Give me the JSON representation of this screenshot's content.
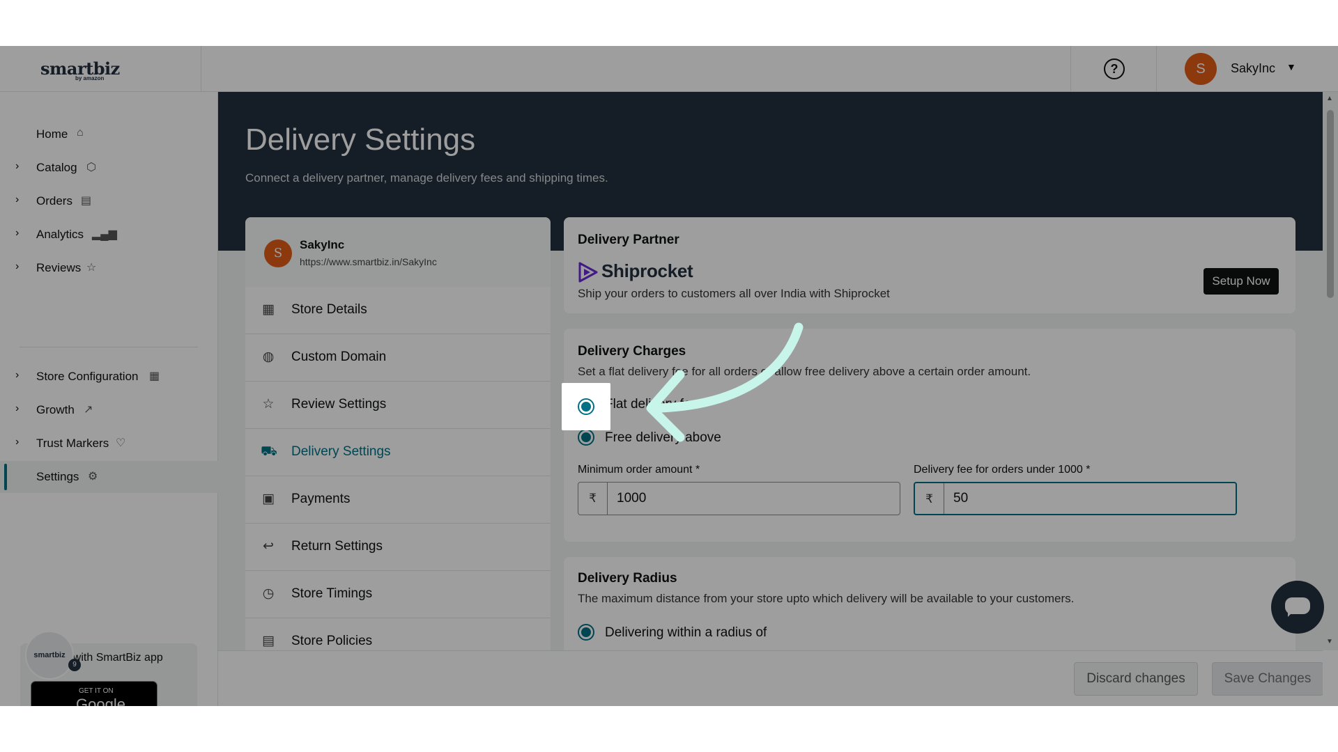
{
  "topbar": {
    "logo_text": "smartbiz",
    "logo_sub": "by amazon",
    "help_label": "?",
    "user_initial": "S",
    "user_name": "SakyInc"
  },
  "sidebar": {
    "items": [
      {
        "label": "Home",
        "icon": "home-icon"
      },
      {
        "label": "Catalog",
        "icon": "box-icon"
      },
      {
        "label": "Orders",
        "icon": "clipboard-icon"
      },
      {
        "label": "Analytics",
        "icon": "bar-chart-icon"
      },
      {
        "label": "Reviews",
        "icon": "star-icon"
      },
      {
        "label": "Store Configuration",
        "icon": "store-icon"
      },
      {
        "label": "Growth",
        "icon": "trend-up-icon"
      },
      {
        "label": "Trust Markers",
        "icon": "heart-badge-icon"
      },
      {
        "label": "Settings",
        "icon": "gear-icon"
      }
    ],
    "promo_text": "Do more with SmartBiz app",
    "gplay_small": "GET IT ON",
    "gplay_big": "Google Play",
    "app_icon_text": "smartbiz",
    "app_badge": "9"
  },
  "page": {
    "title": "Delivery Settings",
    "subtitle": "Connect a delivery partner, manage delivery fees and shipping times."
  },
  "store": {
    "initial": "S",
    "name": "SakyInc",
    "url": "https://www.smartbiz.in/SakyInc"
  },
  "settings_menu": [
    {
      "label": "Store Details",
      "icon": "storefront-icon"
    },
    {
      "label": "Custom Domain",
      "icon": "globe-icon"
    },
    {
      "label": "Review Settings",
      "icon": "star-outline-icon"
    },
    {
      "label": "Delivery Settings",
      "icon": "truck-icon"
    },
    {
      "label": "Payments",
      "icon": "money-icon"
    },
    {
      "label": "Return Settings",
      "icon": "return-arrow-icon"
    },
    {
      "label": "Store Timings",
      "icon": "clock-icon"
    },
    {
      "label": "Store Policies",
      "icon": "document-icon"
    }
  ],
  "delivery_partner": {
    "title": "Delivery Partner",
    "partner_name": "Shiprocket",
    "description": "Ship your orders to customers all over India with Shiprocket",
    "button": "Setup Now"
  },
  "delivery_charges": {
    "title": "Delivery Charges",
    "description": "Set a flat delivery fee for all orders or allow free delivery above a certain order amount.",
    "option_flat": "Flat delivery fee",
    "option_free": "Free delivery above",
    "min_order_label": "Minimum order amount *",
    "min_order_value": "1000",
    "fee_label": "Delivery fee for orders under 1000 *",
    "fee_value": "50",
    "currency": "₹"
  },
  "delivery_radius": {
    "title": "Delivery Radius",
    "description": "The maximum distance from your store upto which delivery will be available to your customers.",
    "option_radius": "Delivering within a radius of"
  },
  "footer": {
    "discard": "Discard changes",
    "save": "Save Changes"
  },
  "colors": {
    "accent": "#007185",
    "header_dark": "#232f3e",
    "avatar": "#e25d18",
    "arrow": "#c8f5ea"
  }
}
